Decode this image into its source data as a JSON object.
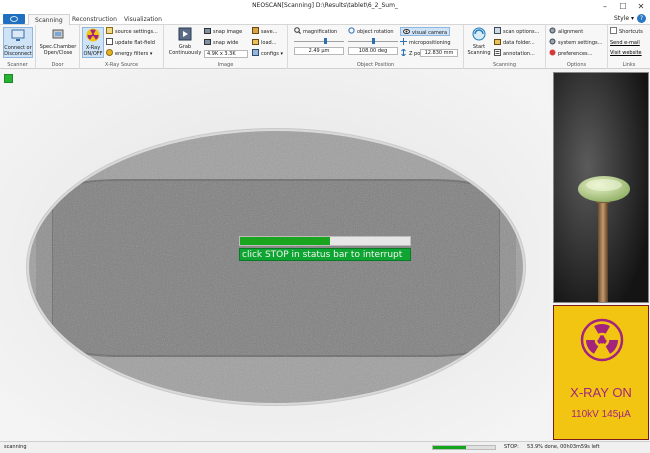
{
  "window": {
    "title": "NEOSCAN[Scanning] D:\\Results\\tablet\\6_2_Sum_",
    "minimize": "–",
    "maximize": "☐",
    "close": "✕"
  },
  "tabs": [
    {
      "label": "Scanning",
      "active": true
    },
    {
      "label": "Reconstruction",
      "active": false
    },
    {
      "label": "Visualization",
      "active": false
    }
  ],
  "style_menu": "Style ▾",
  "help_icon": "?",
  "ribbon": {
    "scanner": {
      "label": "Scanner",
      "connect": "Connect or Disconnect"
    },
    "door": {
      "label": "Door",
      "spec_chamber": "Spec.Chamber Open/Close"
    },
    "xray_source": {
      "label": "X-Ray Source",
      "xray_onoff": "X-Ray ON/OFF",
      "source_settings": "source settings...",
      "update_flat_field": "update flat-field",
      "energy_filters": "energy filters ▾"
    },
    "image": {
      "label": "Image",
      "grab_continuously": "Grab Continuously",
      "snap_image": "snap image",
      "snap_wide": "snap wide",
      "resolution": "4.9K x 3.3K",
      "save": "save...",
      "load": "load...",
      "configs": "configs ▾"
    },
    "object_position": {
      "label": "Object Position",
      "magnification": "magnification",
      "magnification_value": "2.49 µm",
      "object_rotation": "object rotation",
      "rotation_value": "108.00 deg",
      "visual_camera": "visual camera",
      "micropositioning": "micropositioning",
      "z_pos_label": "Z pos",
      "z_pos_value": "12.830 mm"
    },
    "scanning": {
      "label": "Scanning",
      "start_scanning": "Start Scanning",
      "scan_options": "scan options...",
      "data_folder": "data folder...",
      "annotation": "annotation..."
    },
    "options": {
      "label": "Options",
      "alignment": "alignment",
      "system_settings": "system settings...",
      "preferences": "preferences..."
    },
    "links": {
      "label": "Links",
      "shortcuts": "Shortcuts",
      "send_email": "Send e-mail",
      "visit_website": "Visit website"
    }
  },
  "scan_overlay": {
    "progress": 0.53,
    "message": "click STOP in status bar to interrupt"
  },
  "xray_indicator": {
    "status": "X-RAY ON",
    "params": "110kV 145µA",
    "color": "#a3247c",
    "background": "#f2c512"
  },
  "statusbar": {
    "state": "scanning",
    "progress": 0.539,
    "stop_label": "STOP:",
    "detail": "53.9% done, 00h03m59s left"
  },
  "colors": {
    "accent": "#1e6fc0",
    "ok_green": "#27b233",
    "progress_green": "#1aa51f"
  }
}
